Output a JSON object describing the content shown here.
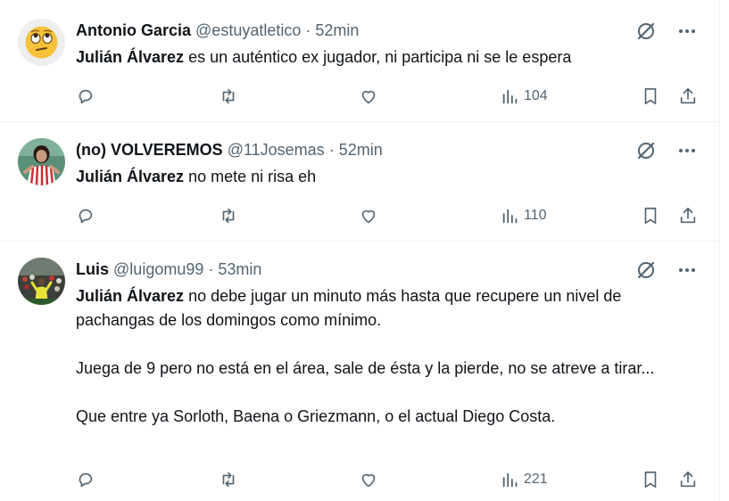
{
  "tweets": [
    {
      "name": "Antonio Garcia",
      "handle": "@estuyatletico",
      "sep": "·",
      "time": "52min",
      "mention": "Julián Álvarez",
      "text": " es un auténtico ex jugador, ni participa ni se le espera",
      "views": "104",
      "avatar": "eye-roll-emoji-avatar"
    },
    {
      "name": "(no) VOLVEREMOS",
      "handle": "@11Josemas",
      "sep": "·",
      "time": "52min",
      "mention": "Julián Álvarez",
      "text": " no mete ni risa eh",
      "views": "110",
      "avatar": "woman-in-striped-shirt-avatar"
    },
    {
      "name": "Luis",
      "handle": "@luigomu99",
      "sep": "·",
      "time": "53min",
      "mention": "Julián Álvarez",
      "text": " no debe jugar un minuto más hasta que recupere un nivel de pachangas de los domingos como mínimo.\n\nJuega de 9 pero no está en el área, sale de ésta y la pierde, no se atreve a tirar...\n\nQue entre ya Sorloth, Baena o Griezmann, o el actual Diego Costa.",
      "views": "221",
      "avatar": "stadium-crowd-avatar"
    }
  ],
  "colors": {
    "text": "#0f1419",
    "secondary": "#536471",
    "divider": "#eff3f4"
  },
  "icons": [
    "reply-icon",
    "retweet-icon",
    "like-icon",
    "views-icon",
    "bookmark-icon",
    "share-icon",
    "grok-icon",
    "more-icon"
  ]
}
